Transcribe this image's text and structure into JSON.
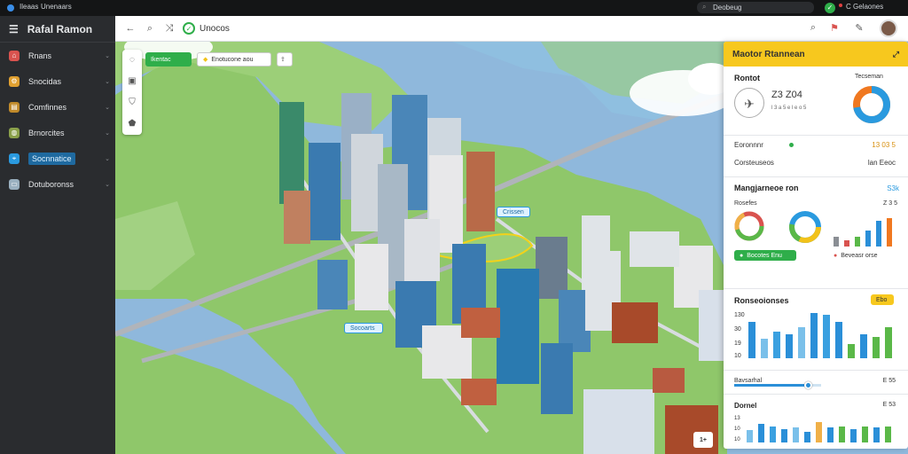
{
  "topbar": {
    "left_label_1": "Ileaas",
    "left_label_2": "Unenaars",
    "search_text": "Deobeug",
    "status_text": "C Gelaones"
  },
  "sidebar": {
    "title": "Rafal Ramon",
    "items": [
      {
        "label": "Rnans",
        "icon": "home-icon",
        "color": "#d9534f"
      },
      {
        "label": "Snocidas",
        "icon": "settings-icon",
        "color": "#e0a030"
      },
      {
        "label": "Comfinnes",
        "icon": "folder-icon",
        "color": "#c08a2a"
      },
      {
        "label": "Brnorcites",
        "icon": "globe-icon",
        "color": "#8aa04a"
      },
      {
        "label": "Socnnatice",
        "icon": "map-pin-icon",
        "color": "#2a9adf",
        "active": true
      },
      {
        "label": "Dotuboronss",
        "icon": "monitor-icon",
        "color": "#9ab0c0"
      }
    ]
  },
  "toolbar": {
    "title": "Unocos"
  },
  "map_overlay": {
    "chip_green": "Ikentac",
    "chip_tag": "Enotucone aou",
    "label_1": "Crissen",
    "label_2": "Socoarts",
    "zoom_btn": "1+"
  },
  "panel": {
    "title": "Maotor Rtannean",
    "rooms": {
      "label": "Rontot",
      "value": "Z3 Z04",
      "sub": "l 3 a 5 e l e o 5",
      "pie_label": "Tecseman",
      "pie_pct": 72
    },
    "kv_rows": [
      {
        "k": "Eoronnnr",
        "v": "13 03 5"
      },
      {
        "k": "Corsteuseos",
        "v": "lan Eeoc"
      }
    ],
    "mgmt": {
      "title": "Mangjarneoe ron",
      "link": "S3k",
      "sub_label": "Rosefes",
      "sub_value": "Z 3 5"
    },
    "mgmt_bars": [
      0.3,
      0.2,
      0.3,
      0.5,
      0.8,
      0.9
    ],
    "mgmt_btn_green": "Bocotes Enu",
    "mgmt_btn_red": "Beveasr orse",
    "reports": {
      "title": "Ronseoionses",
      "tag": "Ebo",
      "y_max": "130",
      "y_mid": "30",
      "y_low": "19",
      "y_min": "10"
    },
    "reports_bars": [
      {
        "v": 0.75,
        "c": "#2a8fd8"
      },
      {
        "v": 0.4,
        "c": "#7ac0ea"
      },
      {
        "v": 0.55,
        "c": "#3aa0e0"
      },
      {
        "v": 0.5,
        "c": "#2a8fd8"
      },
      {
        "v": 0.65,
        "c": "#7ac0ea"
      },
      {
        "v": 0.95,
        "c": "#2a8fd8"
      },
      {
        "v": 0.9,
        "c": "#3aa0e0"
      },
      {
        "v": 0.75,
        "c": "#2a8fd8"
      },
      {
        "v": 0.3,
        "c": "#5ab848"
      },
      {
        "v": 0.5,
        "c": "#2a8fd8"
      },
      {
        "v": 0.45,
        "c": "#5ab848"
      },
      {
        "v": 0.65,
        "c": "#5ab848"
      }
    ],
    "slider": {
      "label": "Bavsarhal",
      "value": "E 55",
      "fill": 0.85
    },
    "daily": {
      "title": "Dornel",
      "value": "E 53",
      "y1": "13",
      "y2": "10",
      "y3": "10"
    },
    "daily_bars": [
      {
        "v": 0.45,
        "c": "#7ac0ea"
      },
      {
        "v": 0.7,
        "c": "#2a8fd8"
      },
      {
        "v": 0.6,
        "c": "#3aa0e0"
      },
      {
        "v": 0.5,
        "c": "#2a8fd8"
      },
      {
        "v": 0.55,
        "c": "#7ac0ea"
      },
      {
        "v": 0.4,
        "c": "#2a8fd8"
      },
      {
        "v": 0.75,
        "c": "#f0b048"
      },
      {
        "v": 0.55,
        "c": "#2a8fd8"
      },
      {
        "v": 0.6,
        "c": "#5ab848"
      },
      {
        "v": 0.5,
        "c": "#2a8fd8"
      },
      {
        "v": 0.6,
        "c": "#5ab848"
      },
      {
        "v": 0.55,
        "c": "#2a8fd8"
      },
      {
        "v": 0.6,
        "c": "#5ab848"
      }
    ]
  },
  "colors": {
    "accent": "#f7c81e",
    "green": "#2fae4a",
    "blue": "#2a8fd8",
    "red": "#d9534f"
  }
}
